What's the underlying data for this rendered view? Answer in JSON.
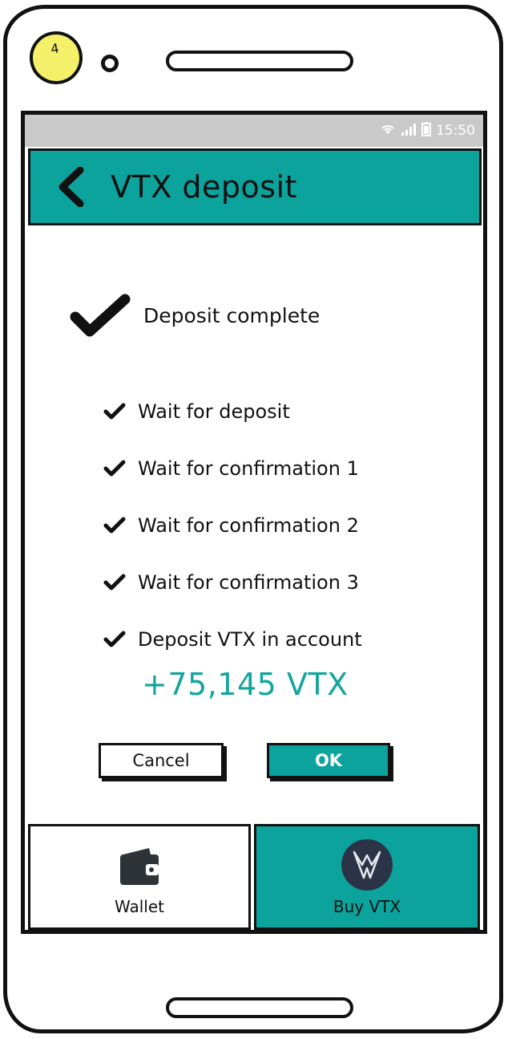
{
  "annotation": {
    "number": "4"
  },
  "status_bar": {
    "time": "15:50",
    "icons": [
      "wifi-icon",
      "signal-icon",
      "battery-icon"
    ]
  },
  "header": {
    "back_icon": "chevron-left-icon",
    "title": "VTX deposit"
  },
  "main": {
    "status_icon": "checkmark-icon",
    "status": "Deposit complete",
    "steps": [
      {
        "label": "Wait for deposit",
        "done": true
      },
      {
        "label": "Wait for confirmation 1",
        "done": true
      },
      {
        "label": "Wait for confirmation 2",
        "done": true
      },
      {
        "label": "Wait for confirmation 3",
        "done": true
      },
      {
        "label": "Deposit VTX in account",
        "done": true
      }
    ],
    "amount": "+75,145 VTX"
  },
  "actions": {
    "cancel": "Cancel",
    "ok": "OK"
  },
  "tab_bar": {
    "tabs": [
      {
        "label": "Wallet",
        "icon": "wallet-icon",
        "active": false
      },
      {
        "label": "Buy VTX",
        "icon": "vtx-logo-icon",
        "active": true
      }
    ]
  },
  "colors": {
    "accent": "#0ba39c",
    "amount": "#12a59d",
    "status_bar": "#c9c9c9",
    "annotation": "#f4f06a"
  }
}
